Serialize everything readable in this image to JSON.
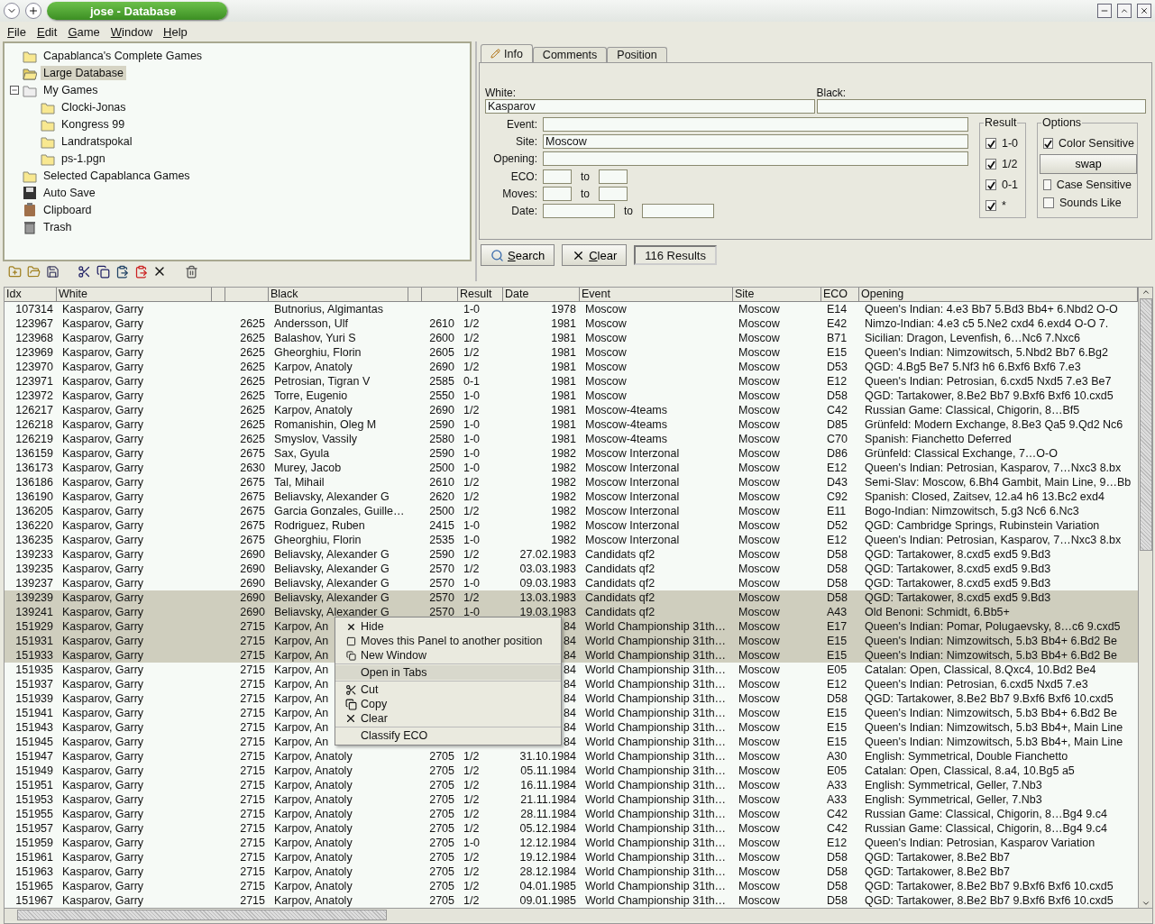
{
  "window": {
    "title": "jose - Database"
  },
  "menu": [
    "File",
    "Edit",
    "Game",
    "Window",
    "Help"
  ],
  "tree": [
    {
      "kind": "folder",
      "label": "Capablanca's Complete Games",
      "selected": false
    },
    {
      "kind": "folder",
      "label": "Large Database",
      "selected": true
    },
    {
      "kind": "group",
      "label": "My Games",
      "selected": false,
      "expanded": true,
      "children": [
        {
          "kind": "folder",
          "label": "Clocki-Jonas",
          "selected": false
        },
        {
          "kind": "folder",
          "label": "Kongress 99",
          "selected": false
        },
        {
          "kind": "folder",
          "label": "Landratspokal",
          "selected": false
        },
        {
          "kind": "folder",
          "label": "ps-1.pgn",
          "selected": false
        }
      ]
    },
    {
      "kind": "folder",
      "label": "Selected Capablanca Games",
      "selected": false
    },
    {
      "kind": "save",
      "label": "Auto Save",
      "selected": false
    },
    {
      "kind": "clipboard",
      "label": "Clipboard",
      "selected": false
    },
    {
      "kind": "trash",
      "label": "Trash",
      "selected": false
    }
  ],
  "search_panel": {
    "tabs": [
      {
        "label": "Info",
        "selected": true
      },
      {
        "label": "Comments",
        "selected": false
      },
      {
        "label": "Position",
        "selected": false
      }
    ],
    "white": {
      "label": "White:",
      "value": "Kasparov"
    },
    "black": {
      "label": "Black:"
    },
    "fields": [
      {
        "label": "Event:"
      },
      {
        "label": "Site:",
        "value": "Moscow"
      },
      {
        "label": "Opening:"
      }
    ],
    "ranges": [
      {
        "label": "ECO:",
        "to": "to",
        "kind": "short"
      },
      {
        "label": "Moves:",
        "to": "to",
        "kind": "short"
      },
      {
        "label": "Date:",
        "to": "to",
        "kind": "long"
      }
    ],
    "result": {
      "title": "Result",
      "options": [
        {
          "label": "1-0",
          "checked": true
        },
        {
          "label": "1/2",
          "checked": true
        },
        {
          "label": "0-1",
          "checked": true
        },
        {
          "label": "*",
          "checked": true
        }
      ]
    },
    "options": {
      "title": "Options",
      "items": [
        {
          "kind": "checkbox",
          "label": "Color Sensitive",
          "checked": true
        },
        {
          "kind": "button",
          "label": "swap"
        },
        {
          "kind": "checkbox",
          "label": "Case Sensitive",
          "checked": false
        },
        {
          "kind": "checkbox",
          "label": "Sounds Like",
          "checked": false
        }
      ]
    },
    "search_button": "Search",
    "clear_button": "Clear",
    "result_count": "116 Results"
  },
  "table": {
    "columns": {
      "idx": "Idx",
      "white": "White",
      "black": "Black",
      "result": "Result",
      "date": "Date",
      "event": "Event",
      "site": "Site",
      "eco": "ECO",
      "opening": "Opening"
    },
    "rows": [
      {
        "idx": "107314",
        "white": "Kasparov, Garry",
        "black": "Butnorius, Algimantas",
        "result": "1-0",
        "date": "1978",
        "event": "Moscow",
        "site": "Moscow",
        "eco": "E14",
        "opening": "Queen's Indian: 4.e3 Bb7 5.Bd3 Bb4+ 6.Nbd2 O-O",
        "selected": false
      },
      {
        "idx": "123967",
        "white": "Kasparov, Garry",
        "white_elo": "2625",
        "black": "Andersson, Ulf",
        "black_elo": "2610",
        "result": "1/2",
        "date": "1981",
        "event": "Moscow",
        "site": "Moscow",
        "eco": "E42",
        "opening": "Nimzo-Indian: 4.e3 c5 5.Ne2 cxd4 6.exd4 O-O 7.",
        "selected": false
      },
      {
        "idx": "123968",
        "white": "Kasparov, Garry",
        "white_elo": "2625",
        "black": "Balashov, Yuri S",
        "black_elo": "2600",
        "result": "1/2",
        "date": "1981",
        "event": "Moscow",
        "site": "Moscow",
        "eco": "B71",
        "opening": "Sicilian: Dragon, Levenfish, 6…Nc6 7.Nxc6",
        "selected": false
      },
      {
        "idx": "123969",
        "white": "Kasparov, Garry",
        "white_elo": "2625",
        "black": "Gheorghiu, Florin",
        "black_elo": "2605",
        "result": "1/2",
        "date": "1981",
        "event": "Moscow",
        "site": "Moscow",
        "eco": "E15",
        "opening": "Queen's Indian: Nimzowitsch, 5.Nbd2 Bb7 6.Bg2",
        "selected": false
      },
      {
        "idx": "123970",
        "white": "Kasparov, Garry",
        "white_elo": "2625",
        "black": "Karpov, Anatoly",
        "black_elo": "2690",
        "result": "1/2",
        "date": "1981",
        "event": "Moscow",
        "site": "Moscow",
        "eco": "D53",
        "opening": "QGD: 4.Bg5 Be7 5.Nf3 h6 6.Bxf6 Bxf6 7.e3",
        "selected": false
      },
      {
        "idx": "123971",
        "white": "Kasparov, Garry",
        "white_elo": "2625",
        "black": "Petrosian, Tigran V",
        "black_elo": "2585",
        "result": "0-1",
        "date": "1981",
        "event": "Moscow",
        "site": "Moscow",
        "eco": "E12",
        "opening": "Queen's Indian: Petrosian, 6.cxd5 Nxd5 7.e3 Be7",
        "selected": false
      },
      {
        "idx": "123972",
        "white": "Kasparov, Garry",
        "white_elo": "2625",
        "black": "Torre, Eugenio",
        "black_elo": "2550",
        "result": "1-0",
        "date": "1981",
        "event": "Moscow",
        "site": "Moscow",
        "eco": "D58",
        "opening": "QGD: Tartakower, 8.Be2 Bb7 9.Bxf6 Bxf6 10.cxd5",
        "selected": false
      },
      {
        "idx": "126217",
        "white": "Kasparov, Garry",
        "white_elo": "2625",
        "black": "Karpov, Anatoly",
        "black_elo": "2690",
        "result": "1/2",
        "date": "1981",
        "event": "Moscow-4teams",
        "site": "Moscow",
        "eco": "C42",
        "opening": "Russian Game: Classical, Chigorin, 8…Bf5",
        "selected": false
      },
      {
        "idx": "126218",
        "white": "Kasparov, Garry",
        "white_elo": "2625",
        "black": "Romanishin, Oleg M",
        "black_elo": "2590",
        "result": "1-0",
        "date": "1981",
        "event": "Moscow-4teams",
        "site": "Moscow",
        "eco": "D85",
        "opening": "Grünfeld: Modern Exchange, 8.Be3 Qa5 9.Qd2 Nc6",
        "selected": false
      },
      {
        "idx": "126219",
        "white": "Kasparov, Garry",
        "white_elo": "2625",
        "black": "Smyslov, Vassily",
        "black_elo": "2580",
        "result": "1-0",
        "date": "1981",
        "event": "Moscow-4teams",
        "site": "Moscow",
        "eco": "C70",
        "opening": "Spanish: Fianchetto Deferred",
        "selected": false
      },
      {
        "idx": "136159",
        "white": "Kasparov, Garry",
        "white_elo": "2675",
        "black": "Sax, Gyula",
        "black_elo": "2590",
        "result": "1-0",
        "date": "1982",
        "event": "Moscow Interzonal",
        "site": "Moscow",
        "eco": "D86",
        "opening": "Grünfeld: Classical Exchange, 7…O-O",
        "selected": false
      },
      {
        "idx": "136173",
        "white": "Kasparov, Garry",
        "white_elo": "2630",
        "black": "Murey, Jacob",
        "black_elo": "2500",
        "result": "1-0",
        "date": "1982",
        "event": "Moscow Interzonal",
        "site": "Moscow",
        "eco": "E12",
        "opening": "Queen's Indian: Petrosian, Kasparov, 7…Nxc3 8.bx",
        "selected": false
      },
      {
        "idx": "136186",
        "white": "Kasparov, Garry",
        "white_elo": "2675",
        "black": "Tal, Mihail",
        "black_elo": "2610",
        "result": "1/2",
        "date": "1982",
        "event": "Moscow Interzonal",
        "site": "Moscow",
        "eco": "D43",
        "opening": "Semi-Slav: Moscow, 6.Bh4 Gambit, Main Line, 9…Bb",
        "selected": false
      },
      {
        "idx": "136190",
        "white": "Kasparov, Garry",
        "white_elo": "2675",
        "black": "Beliavsky, Alexander G",
        "black_elo": "2620",
        "result": "1/2",
        "date": "1982",
        "event": "Moscow Interzonal",
        "site": "Moscow",
        "eco": "C92",
        "opening": "Spanish: Closed, Zaitsev, 12.a4 h6 13.Bc2 exd4",
        "selected": false
      },
      {
        "idx": "136205",
        "white": "Kasparov, Garry",
        "white_elo": "2675",
        "black": "Garcia Gonzales, Guille…",
        "black_elo": "2500",
        "result": "1/2",
        "date": "1982",
        "event": "Moscow Interzonal",
        "site": "Moscow",
        "eco": "E11",
        "opening": "Bogo-Indian: Nimzowitsch, 5.g3 Nc6 6.Nc3",
        "selected": false
      },
      {
        "idx": "136220",
        "white": "Kasparov, Garry",
        "white_elo": "2675",
        "black": "Rodriguez, Ruben",
        "black_elo": "2415",
        "result": "1-0",
        "date": "1982",
        "event": "Moscow Interzonal",
        "site": "Moscow",
        "eco": "D52",
        "opening": "QGD: Cambridge Springs, Rubinstein Variation",
        "selected": false
      },
      {
        "idx": "136235",
        "white": "Kasparov, Garry",
        "white_elo": "2675",
        "black": "Gheorghiu, Florin",
        "black_elo": "2535",
        "result": "1-0",
        "date": "1982",
        "event": "Moscow Interzonal",
        "site": "Moscow",
        "eco": "E12",
        "opening": "Queen's Indian: Petrosian, Kasparov, 7…Nxc3 8.bx",
        "selected": false
      },
      {
        "idx": "139233",
        "white": "Kasparov, Garry",
        "white_elo": "2690",
        "black": "Beliavsky, Alexander G",
        "black_elo": "2590",
        "result": "1/2",
        "date": "27.02.1983",
        "event": "Candidats qf2",
        "site": "Moscow",
        "eco": "D58",
        "opening": "QGD: Tartakower, 8.cxd5 exd5 9.Bd3",
        "selected": false
      },
      {
        "idx": "139235",
        "white": "Kasparov, Garry",
        "white_elo": "2690",
        "black": "Beliavsky, Alexander G",
        "black_elo": "2570",
        "result": "1/2",
        "date": "03.03.1983",
        "event": "Candidats qf2",
        "site": "Moscow",
        "eco": "D58",
        "opening": "QGD: Tartakower, 8.cxd5 exd5 9.Bd3",
        "selected": false
      },
      {
        "idx": "139237",
        "white": "Kasparov, Garry",
        "white_elo": "2690",
        "black": "Beliavsky, Alexander G",
        "black_elo": "2570",
        "result": "1-0",
        "date": "09.03.1983",
        "event": "Candidats qf2",
        "site": "Moscow",
        "eco": "D58",
        "opening": "QGD: Tartakower, 8.cxd5 exd5 9.Bd3",
        "selected": false
      },
      {
        "idx": "139239",
        "white": "Kasparov, Garry",
        "white_elo": "2690",
        "black": "Beliavsky, Alexander G",
        "black_elo": "2570",
        "result": "1/2",
        "date": "13.03.1983",
        "event": "Candidats qf2",
        "site": "Moscow",
        "eco": "D58",
        "opening": "QGD: Tartakower, 8.cxd5 exd5 9.Bd3",
        "selected": true
      },
      {
        "idx": "139241",
        "white": "Kasparov, Garry",
        "white_elo": "2690",
        "black": "Beliavsky, Alexander G",
        "black_elo": "2570",
        "result": "1-0",
        "date": "19.03.1983",
        "event": "Candidats qf2",
        "site": "Moscow",
        "eco": "A43",
        "opening": "Old Benoni: Schmidt, 6.Bb5+",
        "selected": true
      },
      {
        "idx": "151929",
        "white": "Kasparov, Garry",
        "white_elo": "2715",
        "black": "Karpov, An",
        "date": "84",
        "event": "World Championship 31th…",
        "site": "Moscow",
        "eco": "E17",
        "opening": "Queen's Indian: Pomar, Polugaevsky, 8…c6 9.cxd5",
        "selected": true
      },
      {
        "idx": "151931",
        "white": "Kasparov, Garry",
        "white_elo": "2715",
        "black": "Karpov, An",
        "date": "84",
        "event": "World Championship 31th…",
        "site": "Moscow",
        "eco": "E15",
        "opening": "Queen's Indian: Nimzowitsch, 5.b3 Bb4+ 6.Bd2 Be",
        "selected": true
      },
      {
        "idx": "151933",
        "white": "Kasparov, Garry",
        "white_elo": "2715",
        "black": "Karpov, An",
        "date": "84",
        "event": "World Championship 31th…",
        "site": "Moscow",
        "eco": "E15",
        "opening": "Queen's Indian: Nimzowitsch, 5.b3 Bb4+ 6.Bd2 Be",
        "selected": true
      },
      {
        "idx": "151935",
        "white": "Kasparov, Garry",
        "white_elo": "2715",
        "black": "Karpov, An",
        "date": "84",
        "event": "World Championship 31th…",
        "site": "Moscow",
        "eco": "E05",
        "opening": "Catalan: Open, Classical, 8.Qxc4, 10.Bd2 Be4",
        "selected": false
      },
      {
        "idx": "151937",
        "white": "Kasparov, Garry",
        "white_elo": "2715",
        "black": "Karpov, An",
        "date": "84",
        "event": "World Championship 31th…",
        "site": "Moscow",
        "eco": "E12",
        "opening": "Queen's Indian: Petrosian, 6.cxd5 Nxd5 7.e3",
        "selected": false
      },
      {
        "idx": "151939",
        "white": "Kasparov, Garry",
        "white_elo": "2715",
        "black": "Karpov, An",
        "date": "84",
        "event": "World Championship 31th…",
        "site": "Moscow",
        "eco": "D58",
        "opening": "QGD: Tartakower, 8.Be2 Bb7 9.Bxf6 Bxf6 10.cxd5",
        "selected": false
      },
      {
        "idx": "151941",
        "white": "Kasparov, Garry",
        "white_elo": "2715",
        "black": "Karpov, An",
        "date": "84",
        "event": "World Championship 31th…",
        "site": "Moscow",
        "eco": "E15",
        "opening": "Queen's Indian: Nimzowitsch, 5.b3 Bb4+ 6.Bd2 Be",
        "selected": false
      },
      {
        "idx": "151943",
        "white": "Kasparov, Garry",
        "white_elo": "2715",
        "black": "Karpov, An",
        "date": "84",
        "event": "World Championship 31th…",
        "site": "Moscow",
        "eco": "E15",
        "opening": "Queen's Indian: Nimzowitsch, 5.b3 Bb4+, Main Line",
        "selected": false
      },
      {
        "idx": "151945",
        "white": "Kasparov, Garry",
        "white_elo": "2715",
        "black": "Karpov, An",
        "date": "84",
        "event": "World Championship 31th…",
        "site": "Moscow",
        "eco": "E15",
        "opening": "Queen's Indian: Nimzowitsch, 5.b3 Bb4+, Main Line",
        "selected": false
      },
      {
        "idx": "151947",
        "white": "Kasparov, Garry",
        "white_elo": "2715",
        "black": "Karpov, Anatoly",
        "black_elo": "2705",
        "result": "1/2",
        "date": "31.10.1984",
        "event": "World Championship 31th…",
        "site": "Moscow",
        "eco": "A30",
        "opening": "English: Symmetrical, Double Fianchetto",
        "selected": false
      },
      {
        "idx": "151949",
        "white": "Kasparov, Garry",
        "white_elo": "2715",
        "black": "Karpov, Anatoly",
        "black_elo": "2705",
        "result": "1/2",
        "date": "05.11.1984",
        "event": "World Championship 31th…",
        "site": "Moscow",
        "eco": "E05",
        "opening": "Catalan: Open, Classical, 8.a4, 10.Bg5 a5",
        "selected": false
      },
      {
        "idx": "151951",
        "white": "Kasparov, Garry",
        "white_elo": "2715",
        "black": "Karpov, Anatoly",
        "black_elo": "2705",
        "result": "1/2",
        "date": "16.11.1984",
        "event": "World Championship 31th…",
        "site": "Moscow",
        "eco": "A33",
        "opening": "English: Symmetrical, Geller, 7.Nb3",
        "selected": false
      },
      {
        "idx": "151953",
        "white": "Kasparov, Garry",
        "white_elo": "2715",
        "black": "Karpov, Anatoly",
        "black_elo": "2705",
        "result": "1/2",
        "date": "21.11.1984",
        "event": "World Championship 31th…",
        "site": "Moscow",
        "eco": "A33",
        "opening": "English: Symmetrical, Geller, 7.Nb3",
        "selected": false
      },
      {
        "idx": "151955",
        "white": "Kasparov, Garry",
        "white_elo": "2715",
        "black": "Karpov, Anatoly",
        "black_elo": "2705",
        "result": "1/2",
        "date": "28.11.1984",
        "event": "World Championship 31th…",
        "site": "Moscow",
        "eco": "C42",
        "opening": "Russian Game: Classical, Chigorin, 8…Bg4 9.c4",
        "selected": false
      },
      {
        "idx": "151957",
        "white": "Kasparov, Garry",
        "white_elo": "2715",
        "black": "Karpov, Anatoly",
        "black_elo": "2705",
        "result": "1/2",
        "date": "05.12.1984",
        "event": "World Championship 31th…",
        "site": "Moscow",
        "eco": "C42",
        "opening": "Russian Game: Classical, Chigorin, 8…Bg4 9.c4",
        "selected": false
      },
      {
        "idx": "151959",
        "white": "Kasparov, Garry",
        "white_elo": "2715",
        "black": "Karpov, Anatoly",
        "black_elo": "2705",
        "result": "1-0",
        "date": "12.12.1984",
        "event": "World Championship 31th…",
        "site": "Moscow",
        "eco": "E12",
        "opening": "Queen's Indian: Petrosian, Kasparov Variation",
        "selected": false
      },
      {
        "idx": "151961",
        "white": "Kasparov, Garry",
        "white_elo": "2715",
        "black": "Karpov, Anatoly",
        "black_elo": "2705",
        "result": "1/2",
        "date": "19.12.1984",
        "event": "World Championship 31th…",
        "site": "Moscow",
        "eco": "D58",
        "opening": "QGD: Tartakower, 8.Be2 Bb7",
        "selected": false
      },
      {
        "idx": "151963",
        "white": "Kasparov, Garry",
        "white_elo": "2715",
        "black": "Karpov, Anatoly",
        "black_elo": "2705",
        "result": "1/2",
        "date": "28.12.1984",
        "event": "World Championship 31th…",
        "site": "Moscow",
        "eco": "D58",
        "opening": "QGD: Tartakower, 8.Be2 Bb7",
        "selected": false
      },
      {
        "idx": "151965",
        "white": "Kasparov, Garry",
        "white_elo": "2715",
        "black": "Karpov, Anatoly",
        "black_elo": "2705",
        "result": "1/2",
        "date": "04.01.1985",
        "event": "World Championship 31th…",
        "site": "Moscow",
        "eco": "D58",
        "opening": "QGD: Tartakower, 8.Be2 Bb7 9.Bxf6 Bxf6 10.cxd5",
        "selected": false
      },
      {
        "idx": "151967",
        "white": "Kasparov, Garry",
        "white_elo": "2715",
        "black": "Karpov, Anatoly",
        "black_elo": "2705",
        "result": "1/2",
        "date": "09.01.1985",
        "event": "World Championship 31th…",
        "site": "Moscow",
        "eco": "D58",
        "opening": "QGD: Tartakower, 8.Be2 Bb7 9.Bxf6 Bxf6 10.cxd5",
        "selected": false
      }
    ]
  },
  "context_menu": [
    {
      "kind": "item",
      "label": "Hide",
      "highlighted": false
    },
    {
      "kind": "item",
      "label": "Moves this Panel to another position",
      "highlighted": false
    },
    {
      "kind": "item",
      "label": "New Window",
      "highlighted": false
    },
    {
      "kind": "separator"
    },
    {
      "kind": "item",
      "label": "Open in Tabs",
      "highlighted": true
    },
    {
      "kind": "separator"
    },
    {
      "kind": "item",
      "label": "Cut",
      "highlighted": false
    },
    {
      "kind": "item",
      "label": "Copy",
      "highlighted": false
    },
    {
      "kind": "item",
      "label": "Clear",
      "highlighted": false
    },
    {
      "kind": "separator"
    },
    {
      "kind": "item",
      "label": "Classify ECO",
      "highlighted": false
    }
  ]
}
